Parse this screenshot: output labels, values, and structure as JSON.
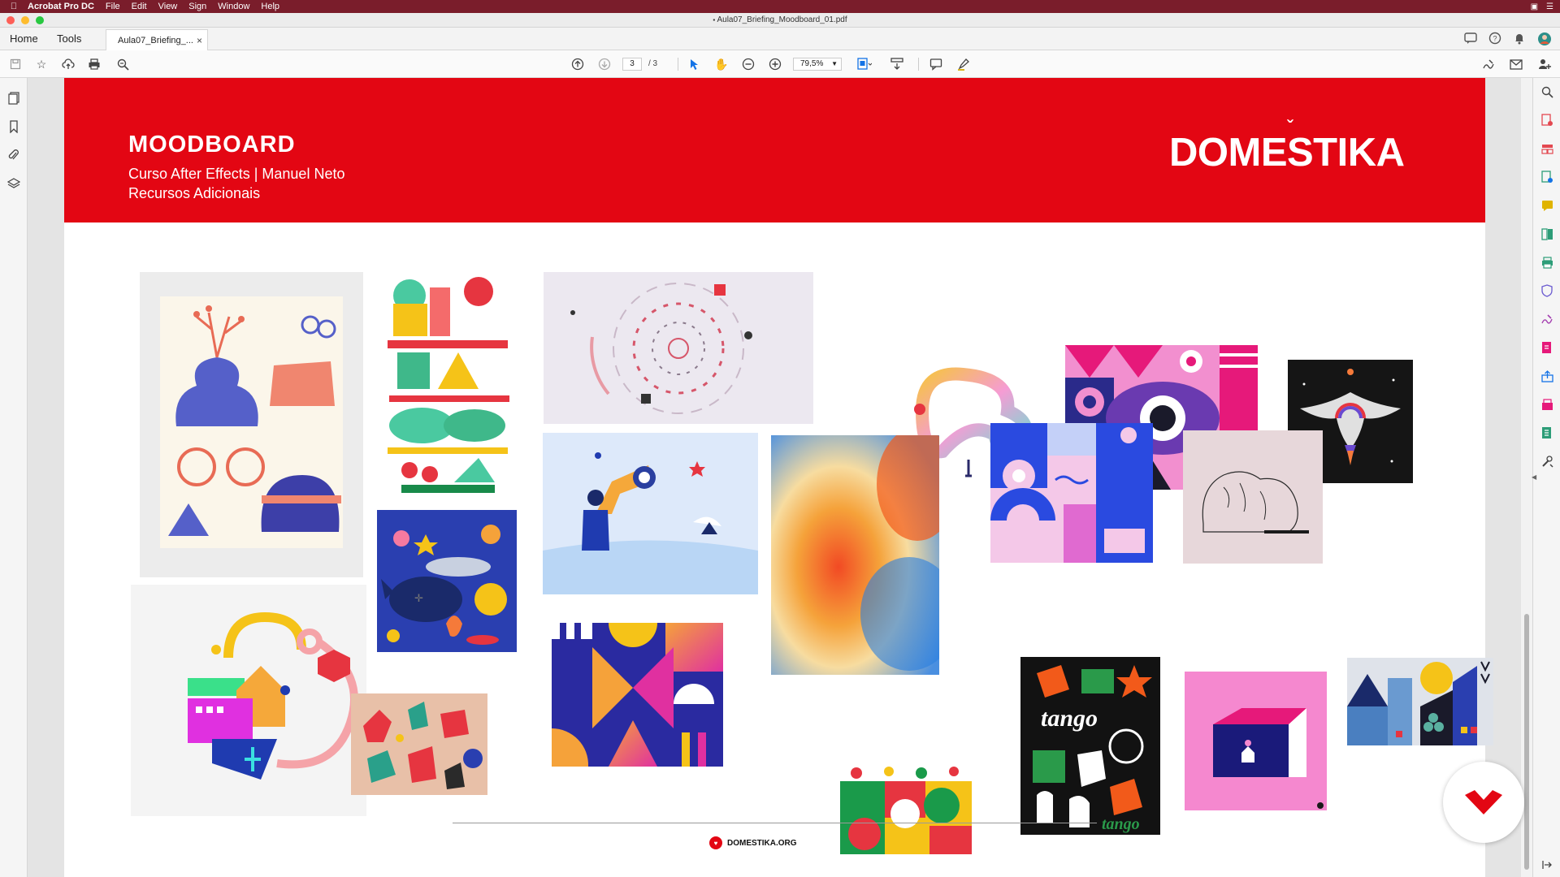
{
  "menubar": {
    "app_name": "Acrobat Pro DC",
    "items": [
      "File",
      "Edit",
      "View",
      "Sign",
      "Window",
      "Help"
    ]
  },
  "window": {
    "title": "Aula07_Briefing_Moodboard_01.pdf"
  },
  "tabs": {
    "home": "Home",
    "tools": "Tools",
    "document": "Aula07_Briefing_...",
    "close": "×"
  },
  "toolbar": {
    "page_current": "3",
    "page_total": "/ 3",
    "zoom": "79,5%"
  },
  "document": {
    "header_title": "MOODBOARD",
    "header_subtitle_1": "Curso After Effects | Manuel Neto",
    "header_subtitle_2": "Recursos Adicionais",
    "logo_text": "DOMESTIKA",
    "footer_text": "DOMESTIKA.ORG"
  },
  "colors": {
    "brand_red": "#e30613",
    "menubar": "#7a1d2b"
  },
  "icons": {
    "left_panel": [
      "pages-icon",
      "bookmark-icon",
      "attachment-icon",
      "layers-icon"
    ],
    "right_panel": [
      "search-tool-icon",
      "export-pdf-icon",
      "organize-pages-icon",
      "create-pdf-icon",
      "comment-icon",
      "combine-icon",
      "print-production-icon",
      "protect-icon",
      "fill-sign-icon",
      "edit-pdf-icon",
      "send-icon",
      "scan-icon",
      "action-wizard-icon",
      "more-tools-icon"
    ]
  }
}
